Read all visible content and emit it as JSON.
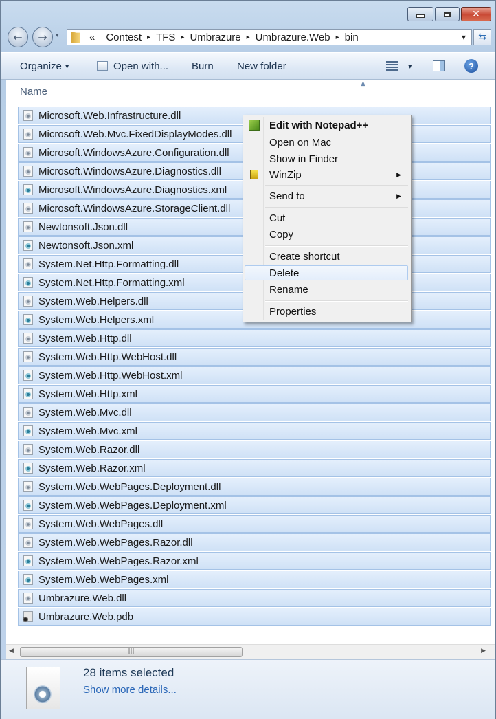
{
  "window": {
    "controls": {
      "minimize": "▁",
      "maximize": "▢",
      "close": "✕"
    }
  },
  "address_bar": {
    "overflow": "«",
    "separator": "▸",
    "segments": [
      "Contest",
      "TFS",
      "Umbrazure",
      "Umbrazure.Web",
      "bin"
    ],
    "dropdown": "▾"
  },
  "toolbar": {
    "organize": "Organize",
    "open_with": "Open with...",
    "burn": "Burn",
    "new_folder": "New folder",
    "dropdown": "▾"
  },
  "list": {
    "column_name": "Name",
    "files": [
      {
        "name": "Microsoft.Web.Infrastructure.dll",
        "type": "dll"
      },
      {
        "name": "Microsoft.Web.Mvc.FixedDisplayModes.dll",
        "type": "dll"
      },
      {
        "name": "Microsoft.WindowsAzure.Configuration.dll",
        "type": "dll"
      },
      {
        "name": "Microsoft.WindowsAzure.Diagnostics.dll",
        "type": "dll"
      },
      {
        "name": "Microsoft.WindowsAzure.Diagnostics.xml",
        "type": "xml"
      },
      {
        "name": "Microsoft.WindowsAzure.StorageClient.dll",
        "type": "dll"
      },
      {
        "name": "Newtonsoft.Json.dll",
        "type": "dll"
      },
      {
        "name": "Newtonsoft.Json.xml",
        "type": "xml"
      },
      {
        "name": "System.Net.Http.Formatting.dll",
        "type": "dll"
      },
      {
        "name": "System.Net.Http.Formatting.xml",
        "type": "xml"
      },
      {
        "name": "System.Web.Helpers.dll",
        "type": "dll"
      },
      {
        "name": "System.Web.Helpers.xml",
        "type": "xml"
      },
      {
        "name": "System.Web.Http.dll",
        "type": "dll"
      },
      {
        "name": "System.Web.Http.WebHost.dll",
        "type": "dll"
      },
      {
        "name": "System.Web.Http.WebHost.xml",
        "type": "xml"
      },
      {
        "name": "System.Web.Http.xml",
        "type": "xml"
      },
      {
        "name": "System.Web.Mvc.dll",
        "type": "dll"
      },
      {
        "name": "System.Web.Mvc.xml",
        "type": "xml"
      },
      {
        "name": "System.Web.Razor.dll",
        "type": "dll"
      },
      {
        "name": "System.Web.Razor.xml",
        "type": "xml"
      },
      {
        "name": "System.Web.WebPages.Deployment.dll",
        "type": "dll"
      },
      {
        "name": "System.Web.WebPages.Deployment.xml",
        "type": "xml"
      },
      {
        "name": "System.Web.WebPages.dll",
        "type": "dll"
      },
      {
        "name": "System.Web.WebPages.Razor.dll",
        "type": "dll"
      },
      {
        "name": "System.Web.WebPages.Razor.xml",
        "type": "xml"
      },
      {
        "name": "System.Web.WebPages.xml",
        "type": "xml"
      },
      {
        "name": "Umbrazure.Web.dll",
        "type": "dll"
      },
      {
        "name": "Umbrazure.Web.pdb",
        "type": "pdb"
      }
    ]
  },
  "context_menu": {
    "items": [
      {
        "label": "Edit with Notepad++",
        "bold": true,
        "icon": "notepad-plus-plus-icon"
      },
      {
        "label": "Open on Mac"
      },
      {
        "label": "Show in Finder"
      },
      {
        "label": "WinZip",
        "submenu": true,
        "icon": "winzip-icon"
      },
      {
        "label": "Send to",
        "submenu": true
      },
      {
        "label": "Cut"
      },
      {
        "label": "Copy"
      },
      {
        "label": "Create shortcut"
      },
      {
        "label": "Delete",
        "highlighted": true
      },
      {
        "label": "Rename"
      },
      {
        "label": "Properties"
      }
    ],
    "submenu_arrow": "▶"
  },
  "details": {
    "selection_count": "28 items selected",
    "show_more": "Show more details..."
  },
  "scrollbar": {
    "left_arrow": "◀",
    "right_arrow": "▶",
    "grip": "|||"
  },
  "colors": {
    "selection": "#cfe1f6",
    "selection_border": "#a4c2e6",
    "link": "#2a67b8"
  }
}
